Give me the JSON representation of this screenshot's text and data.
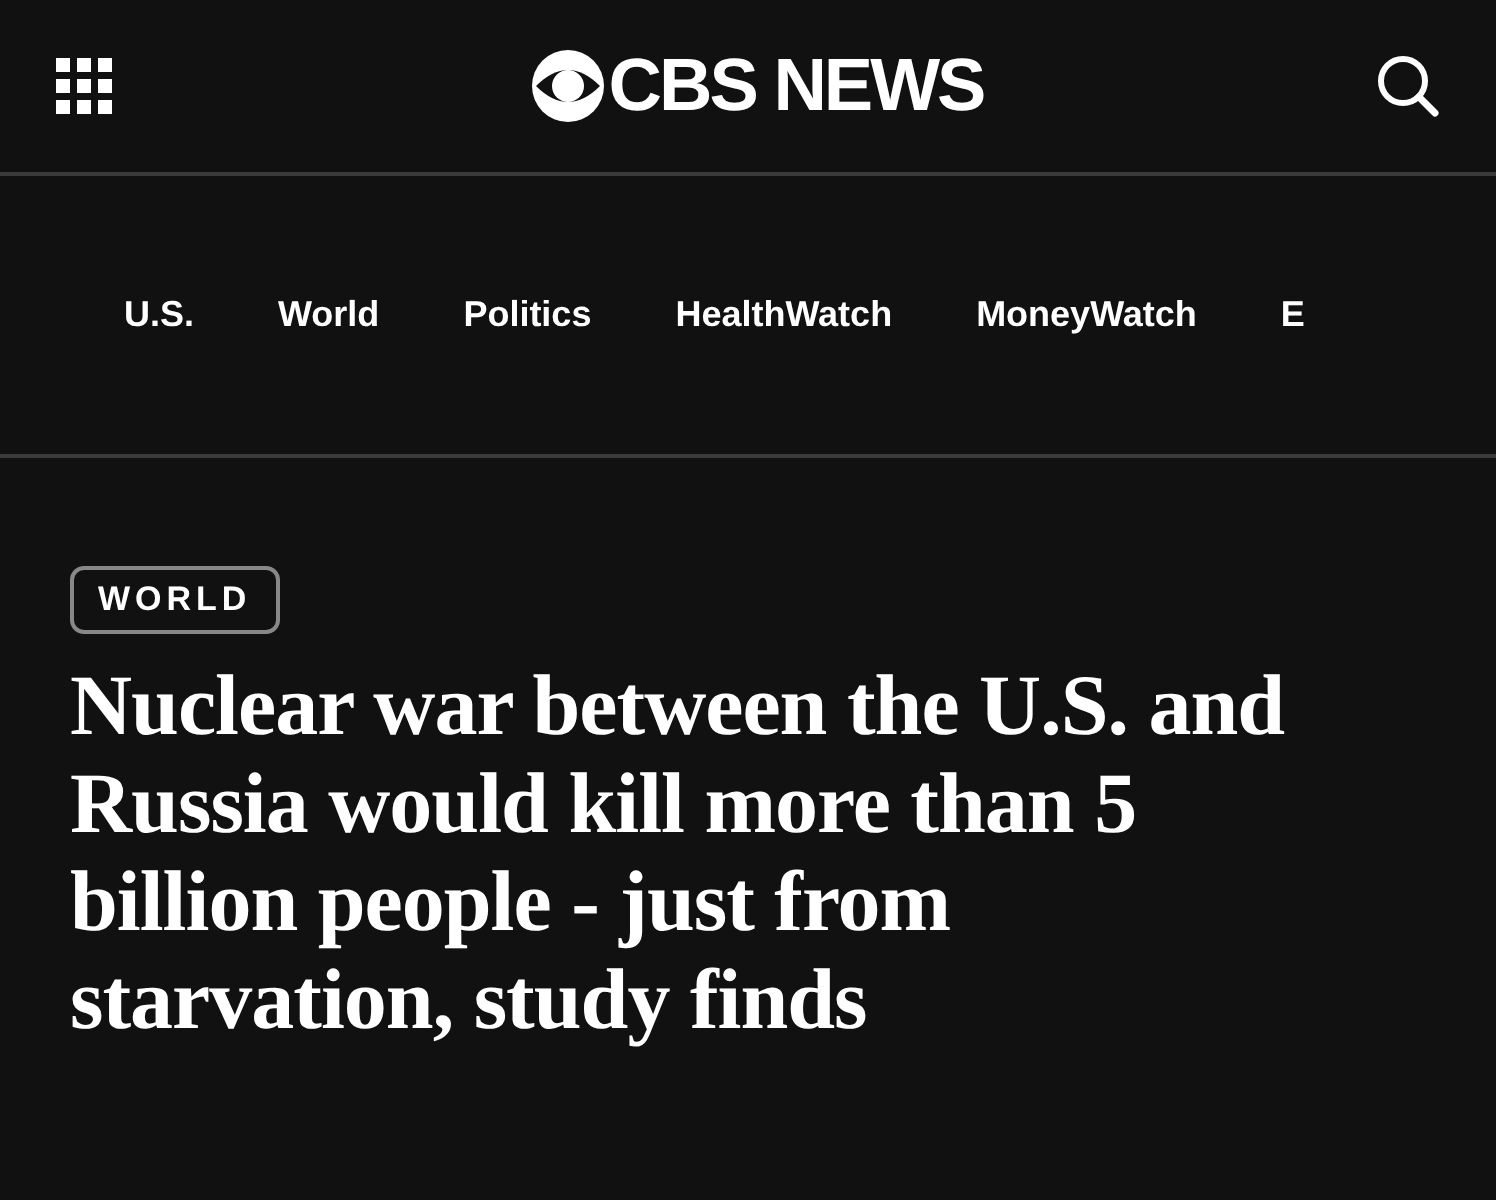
{
  "header": {
    "logo_text": "CBS NEWS"
  },
  "nav": [
    {
      "label": "U.S."
    },
    {
      "label": "World"
    },
    {
      "label": "Politics"
    },
    {
      "label": "HealthWatch"
    },
    {
      "label": "MoneyWatch"
    },
    {
      "label": "E"
    }
  ],
  "article": {
    "section_tag": "WORLD",
    "headline": "Nuclear war between the U.S. and Russia would kill more than 5 billion people - just from starvation, study finds"
  }
}
